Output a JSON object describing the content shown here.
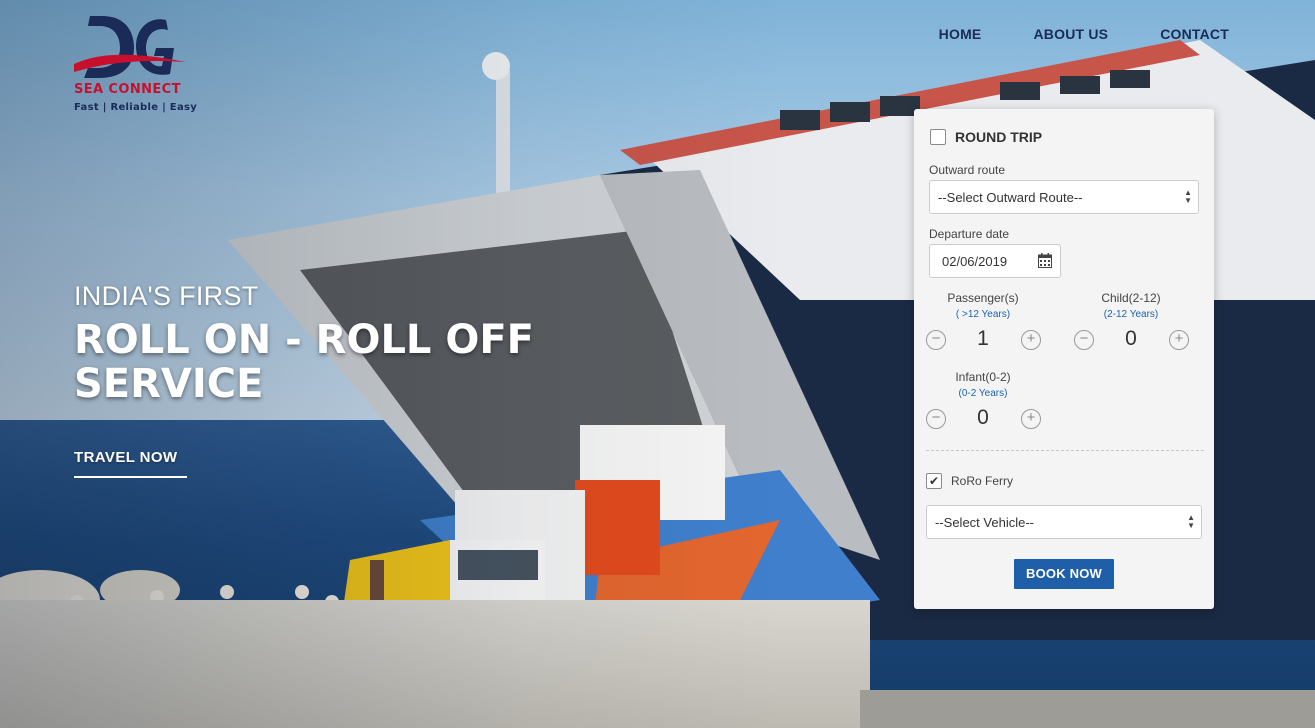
{
  "brand": {
    "name": "SEA CONNECT",
    "tagline": "Fast | Reliable | Easy"
  },
  "nav": {
    "items": [
      "HOME",
      "ABOUT US",
      "CONTACT"
    ]
  },
  "hero": {
    "line1": "INDIA'S FIRST",
    "line2": "ROLL ON - ROLL OFF SERVICE",
    "cta": "TRAVEL NOW"
  },
  "booking": {
    "round_trip_label": "ROUND TRIP",
    "round_trip_checked": false,
    "outward_route_label": "Outward route",
    "outward_route_value": "--Select Outward Route--",
    "departure_date_label": "Departure date",
    "departure_date_value": "02/06/2019",
    "passenger": {
      "label": "Passenger(s)",
      "sub": "( >12 Years)",
      "value": "1"
    },
    "child": {
      "label": "Child(2-12)",
      "sub": "(2-12 Years)",
      "value": "0"
    },
    "infant": {
      "label": "Infant(0-2)",
      "sub": "(0-2 Years)",
      "value": "0"
    },
    "roro_label": "RoRo Ferry",
    "roro_checked": true,
    "vehicle_value": "--Select Vehicle--",
    "book_label": "BOOK NOW"
  },
  "colors": {
    "navy": "#1a2b57",
    "brand_red": "#c8102e",
    "button_blue": "#1f5ea8",
    "link_blue": "#1a63b0"
  }
}
